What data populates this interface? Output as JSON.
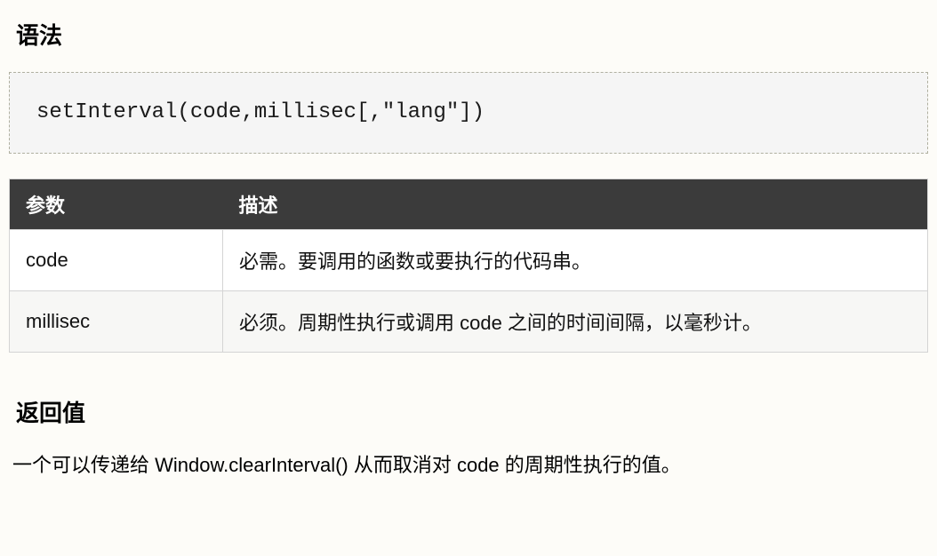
{
  "syntax": {
    "heading": "语法",
    "code": "setInterval(code,millisec[,\"lang\"])"
  },
  "params": {
    "headers": [
      "参数",
      "描述"
    ],
    "rows": [
      {
        "param": "code",
        "desc": "必需。要调用的函数或要执行的代码串。"
      },
      {
        "param": "millisec",
        "desc": "必须。周期性执行或调用 code 之间的时间间隔，以毫秒计。"
      }
    ]
  },
  "returnValue": {
    "heading": "返回值",
    "desc": "一个可以传递给 Window.clearInterval() 从而取消对 code 的周期性执行的值。"
  }
}
